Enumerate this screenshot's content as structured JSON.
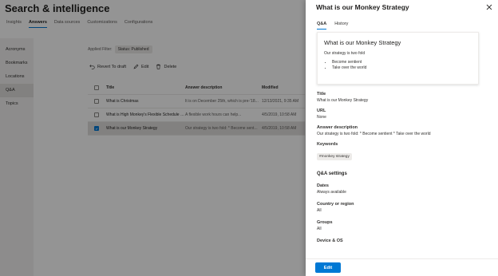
{
  "page": {
    "title": "Search & intelligence",
    "tabs": [
      "Insights",
      "Answers",
      "Data sources",
      "Customizations",
      "Configurations"
    ],
    "active_tab": "Answers"
  },
  "nav": {
    "items": [
      "Acronyms",
      "Bookmarks",
      "Locations",
      "Q&A",
      "Topics"
    ],
    "active": "Q&A"
  },
  "filter": {
    "label": "Applied Filter:",
    "chip": "Status: Published"
  },
  "toolbar": {
    "revert": "Revert To draft",
    "edit": "Edit",
    "delete": "Delete"
  },
  "grid": {
    "headers": {
      "title": "Title",
      "answer": "Answer description",
      "modified": "Modified"
    },
    "rows": [
      {
        "title": "What is Christmas",
        "answer": "It is on December 25th, which is pre-'18...",
        "modified": "12/13/2021, 9:35 AM",
        "selected": false
      },
      {
        "title": "What is High Monkey's Flexible Schedule P...",
        "answer": "A flexible work hours can help...",
        "modified": "4/5/2019, 10:58 AM",
        "selected": false
      },
      {
        "title": "What is our Monkey Strategy",
        "answer": "Our strategy is two fold: * Become sent...",
        "modified": "4/5/2019, 10:58 AM",
        "selected": true
      }
    ]
  },
  "panel": {
    "title": "What is our Monkey Strategy",
    "tabs": [
      "Q&A",
      "History"
    ],
    "active_tab": "Q&A",
    "preview": {
      "title": "What is our Monkey Strategy",
      "text": "Our strategy is two fold",
      "bullets": [
        "Become sentient",
        "Take over the world"
      ]
    },
    "fields": {
      "title_label": "Title",
      "title_value": "What is our Monkey Strategy",
      "url_label": "URL",
      "url_value": "None",
      "answer_label": "Answer description",
      "answer_value": "Our strategy is two fold: * Become sentient * Take over the world",
      "keywords_label": "Keywords",
      "keyword": "#monkey strategy"
    },
    "settings": {
      "heading": "Q&A settings",
      "dates_label": "Dates",
      "dates_value": "Always available",
      "country_label": "Country or region",
      "country_value": "All",
      "groups_label": "Groups",
      "groups_value": "All",
      "device_label": "Device & OS"
    },
    "edit_button": "Edit"
  },
  "colors": {
    "accent": "#0078d4",
    "overlay": "rgba(0,0,0,0.42)"
  }
}
